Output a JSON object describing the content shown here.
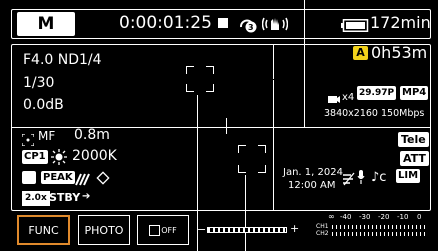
{
  "top_bar": {
    "mode": "M",
    "timecode": "0:00:01:25",
    "rec_status_icon": "stop-square-icon",
    "media_slot": "3",
    "stabilizer_icon": "hand-shake-icon",
    "battery_time": "172min"
  },
  "left_panel": {
    "aperture_nd": "F4.0 ND1/4",
    "shutter": "1/30",
    "gain": "0.0dB"
  },
  "right_panel": {
    "card_badge": "A",
    "remaining": "0h53m",
    "slow_fast_rate": "x4",
    "frame_rate": "29.97P",
    "format": "MP4",
    "resolution_bitrate": "3840x2160 150Mbps",
    "tele_label": "Tele",
    "att_label": "ATT",
    "date": "Jan. 1, 2024",
    "time": "12:00 AM",
    "music_icon": "♪c"
  },
  "bottom_panel": {
    "focus_mode": "MF",
    "focus_distance": "0.8m",
    "custom_picture": "CP1",
    "white_balance": "2000K",
    "peaking_label": "PEAK",
    "magnification": "2.0x",
    "standby": "STBY"
  },
  "buttons": {
    "func": "FUNC",
    "photo": "PHOTO",
    "third": "OFF"
  },
  "audio_meter": {
    "scale_labels": [
      "∞",
      "-40",
      "-30",
      "-20",
      "-10",
      "0"
    ],
    "ch1": "CH1",
    "ch2": "CH2"
  },
  "colors": {
    "accent": "#e08a2c",
    "badge_yellow": "#f2d21b",
    "background": "#000000"
  }
}
